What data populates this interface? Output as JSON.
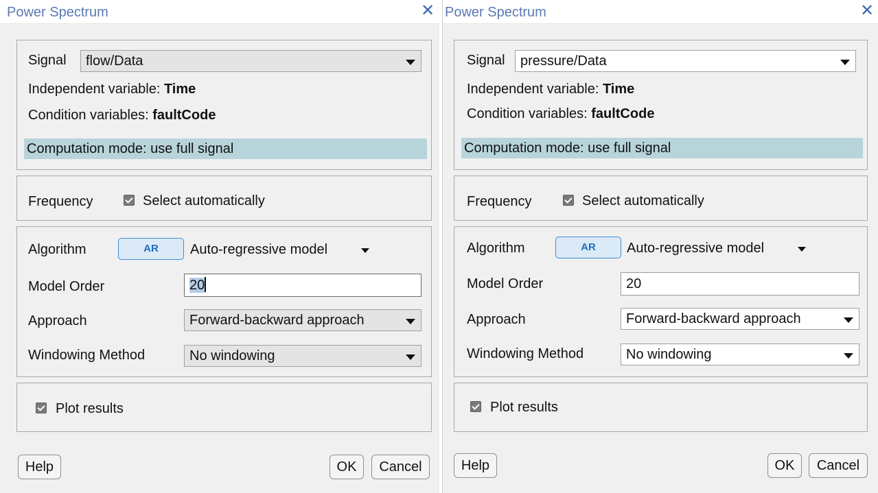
{
  "dialogs": [
    {
      "title": "Power Spectrum",
      "close_glyph": "✕",
      "signal_label": "Signal",
      "signal_value": "flow/Data",
      "independent_label": "Independent variable:",
      "independent_value": "Time",
      "condition_label": "Condition variables:",
      "condition_value": "faultCode",
      "computation_mode": "Computation mode: use full signal",
      "frequency_label": "Frequency",
      "select_auto_label": "Select automatically",
      "select_auto_checked": true,
      "algorithm_label": "Algorithm",
      "algorithm_button": "AR",
      "algorithm_value": "Auto-regressive model",
      "model_order_label": "Model Order",
      "model_order_value": "20",
      "model_order_focused": true,
      "approach_label": "Approach",
      "approach_value": "Forward-backward approach",
      "windowing_label": "Windowing Method",
      "windowing_value": "No windowing",
      "plot_results_label": "Plot results",
      "plot_results_checked": true,
      "help_label": "Help",
      "ok_label": "OK",
      "cancel_label": "Cancel"
    },
    {
      "title": "Power Spectrum",
      "close_glyph": "✕",
      "signal_label": "Signal",
      "signal_value": "pressure/Data",
      "independent_label": "Independent variable:",
      "independent_value": "Time",
      "condition_label": "Condition variables:",
      "condition_value": "faultCode",
      "computation_mode": "Computation mode: use full signal",
      "frequency_label": "Frequency",
      "select_auto_label": "Select automatically",
      "select_auto_checked": true,
      "algorithm_label": "Algorithm",
      "algorithm_button": "AR",
      "algorithm_value": "Auto-regressive model",
      "model_order_label": "Model Order",
      "model_order_value": "20",
      "model_order_focused": false,
      "approach_label": "Approach",
      "approach_value": "Forward-backward approach",
      "windowing_label": "Windowing Method",
      "windowing_value": "No windowing",
      "plot_results_label": "Plot results",
      "plot_results_checked": true,
      "help_label": "Help",
      "ok_label": "OK",
      "cancel_label": "Cancel"
    }
  ],
  "colors": {
    "title_text": "#5a7ab2",
    "close_icon": "#3d6ab3",
    "computation_highlight": "#b8d4db",
    "ar_button_border": "#3b8cd6",
    "dialog_background": "#f0f0f0"
  }
}
